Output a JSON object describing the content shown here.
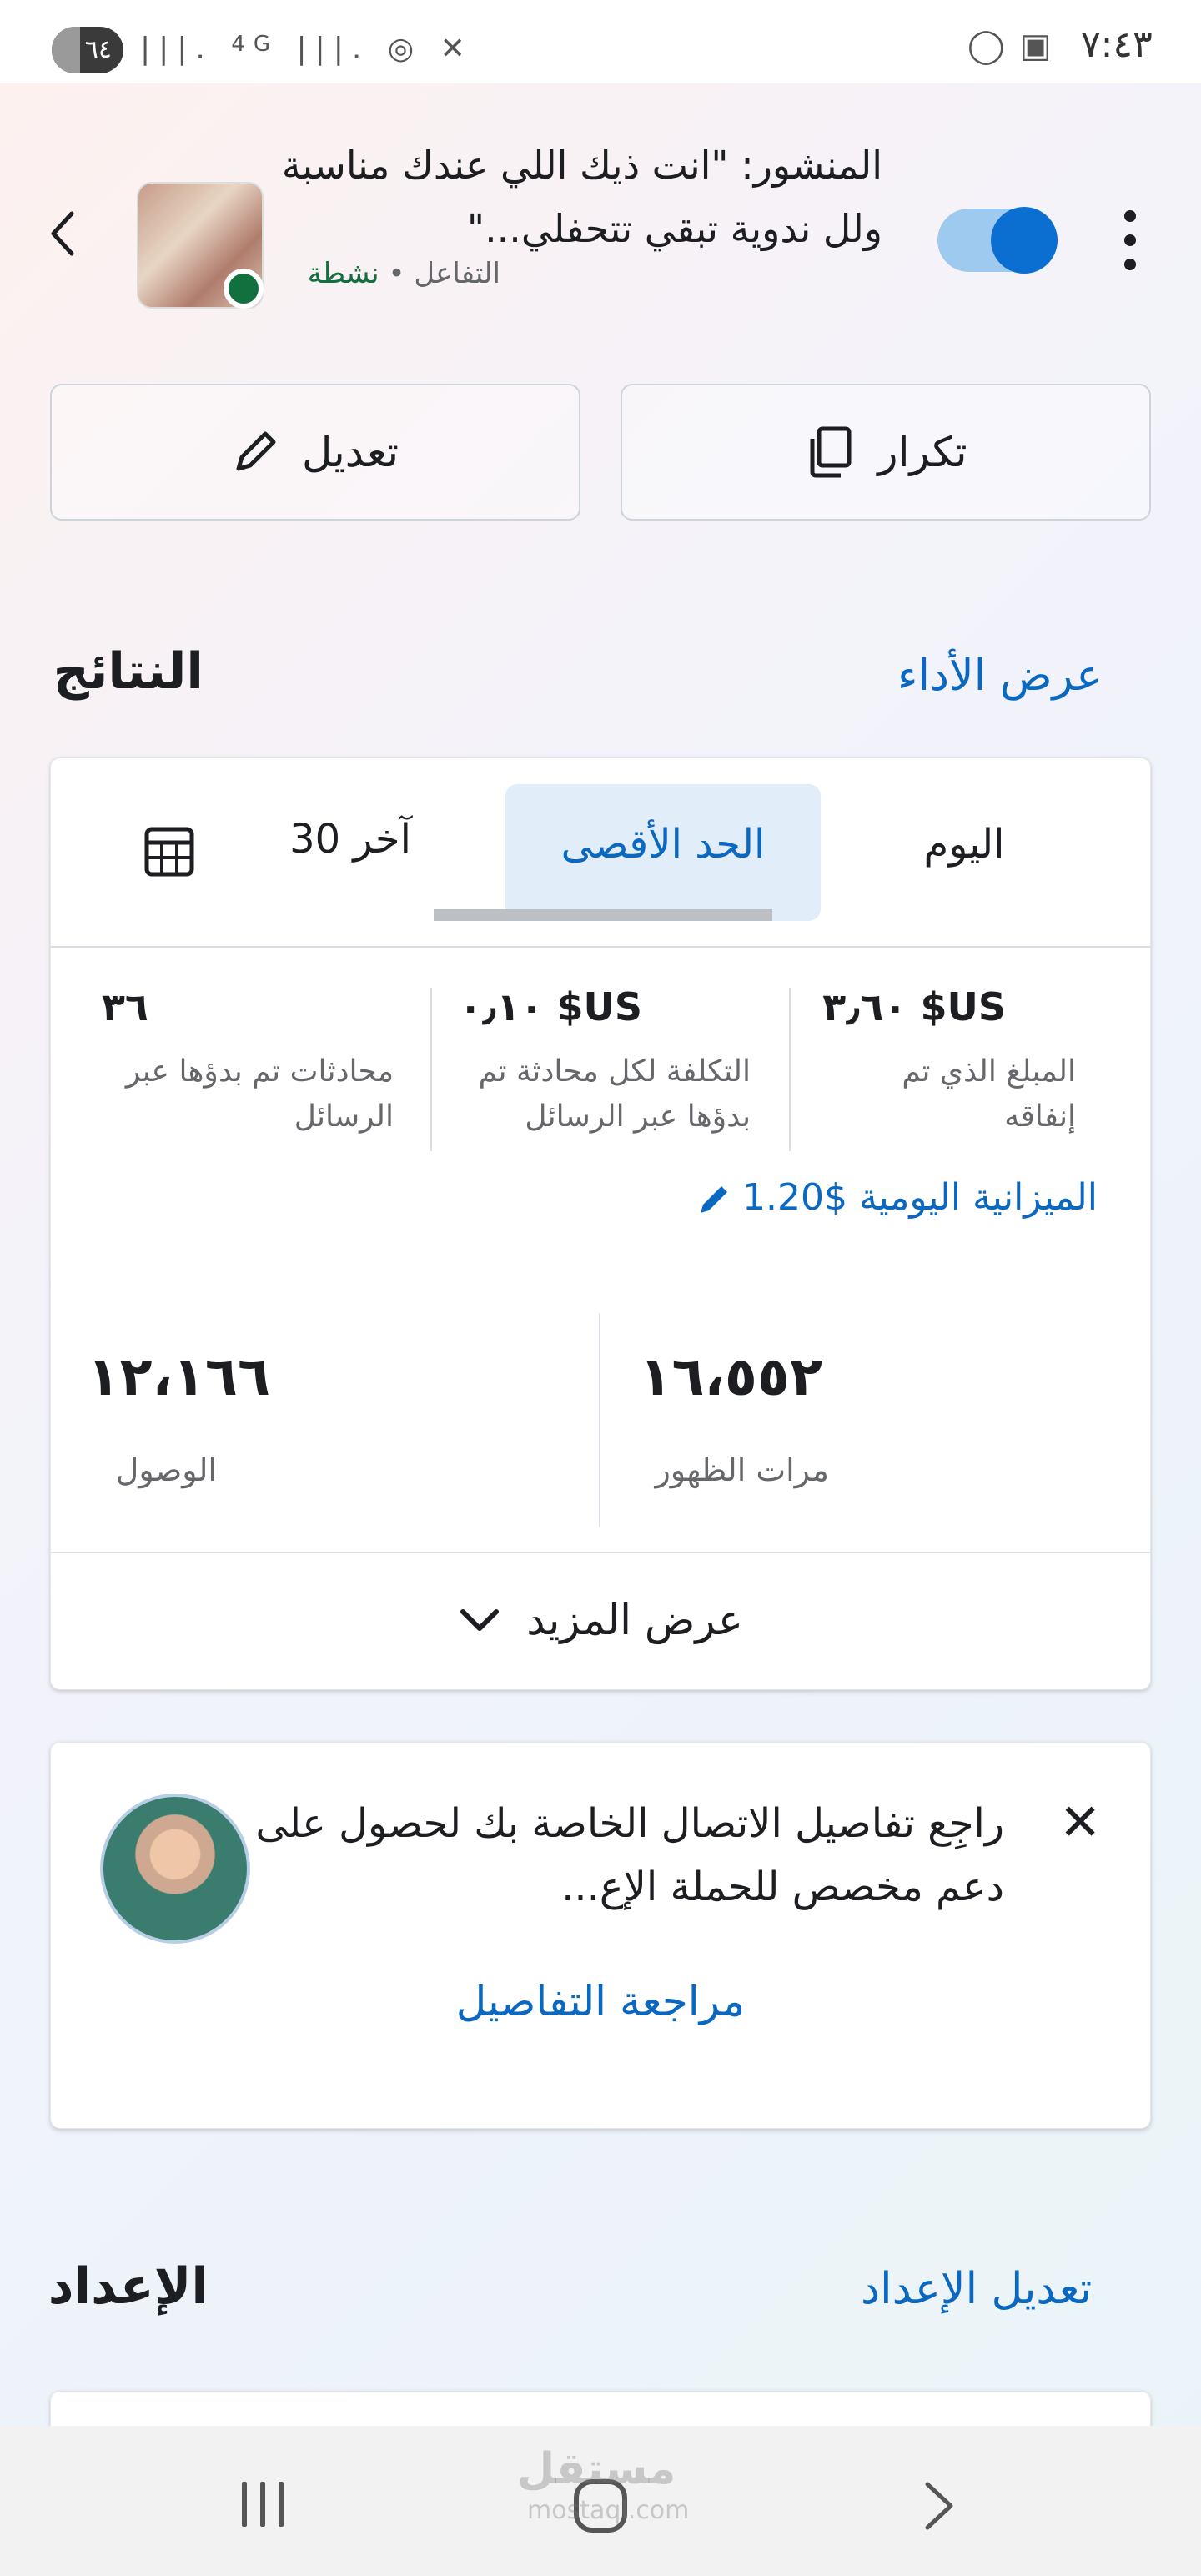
{
  "status_bar": {
    "time": "٧:٤٣",
    "battery": "٦٤",
    "network": "4G"
  },
  "header": {
    "post_title": "المنشور: \"انت ذيك اللي عندك مناسبة ولل ندوية تبقي تتحفلي...\"",
    "objective": "التفاعل",
    "separator": "•",
    "status": "نشطة"
  },
  "actions": {
    "duplicate_label": "تكرار",
    "edit_label": "تعديل"
  },
  "results": {
    "title": "النتائج",
    "view_performance": "عرض الأداء",
    "tabs": [
      {
        "label": "اليوم",
        "selected": false
      },
      {
        "label": "الحد الأقصى",
        "selected": true
      },
      {
        "label": "آخر 30",
        "selected": false
      }
    ],
    "metrics": [
      {
        "value": "US$ ٣٫٦٠",
        "label": "المبلغ الذي تم إنفاقه"
      },
      {
        "value": "US$ ٠٫١٠",
        "label": "التكلفة لكل محادثة تم بدؤها عبر الرسائل"
      },
      {
        "value": "٣٦",
        "label": "محادثات تم بدؤها عبر الرسائل"
      }
    ],
    "daily_budget_amount": "$1.20",
    "daily_budget_label": "الميزانية اليومية",
    "impressions_value": "١٦،٥٥٢",
    "impressions_label": "مرات الظهور",
    "reach_value": "١٢،١٦٦",
    "reach_label": "الوصول",
    "show_more": "عرض المزيد"
  },
  "notice": {
    "text": "راجِع تفاصيل الاتصال الخاصة بك لحصول على دعم مخصص للحملة الإع...",
    "link": "مراجعة التفاصيل"
  },
  "setup": {
    "title": "الإعداد",
    "edit_setup": "تعديل الإعداد"
  },
  "watermark": {
    "brand": "مستقل",
    "domain": "mostaql.com"
  },
  "colors": {
    "accent": "#0a68c0",
    "active_green": "#11703d",
    "toggle_on": "#0a6fd1"
  }
}
